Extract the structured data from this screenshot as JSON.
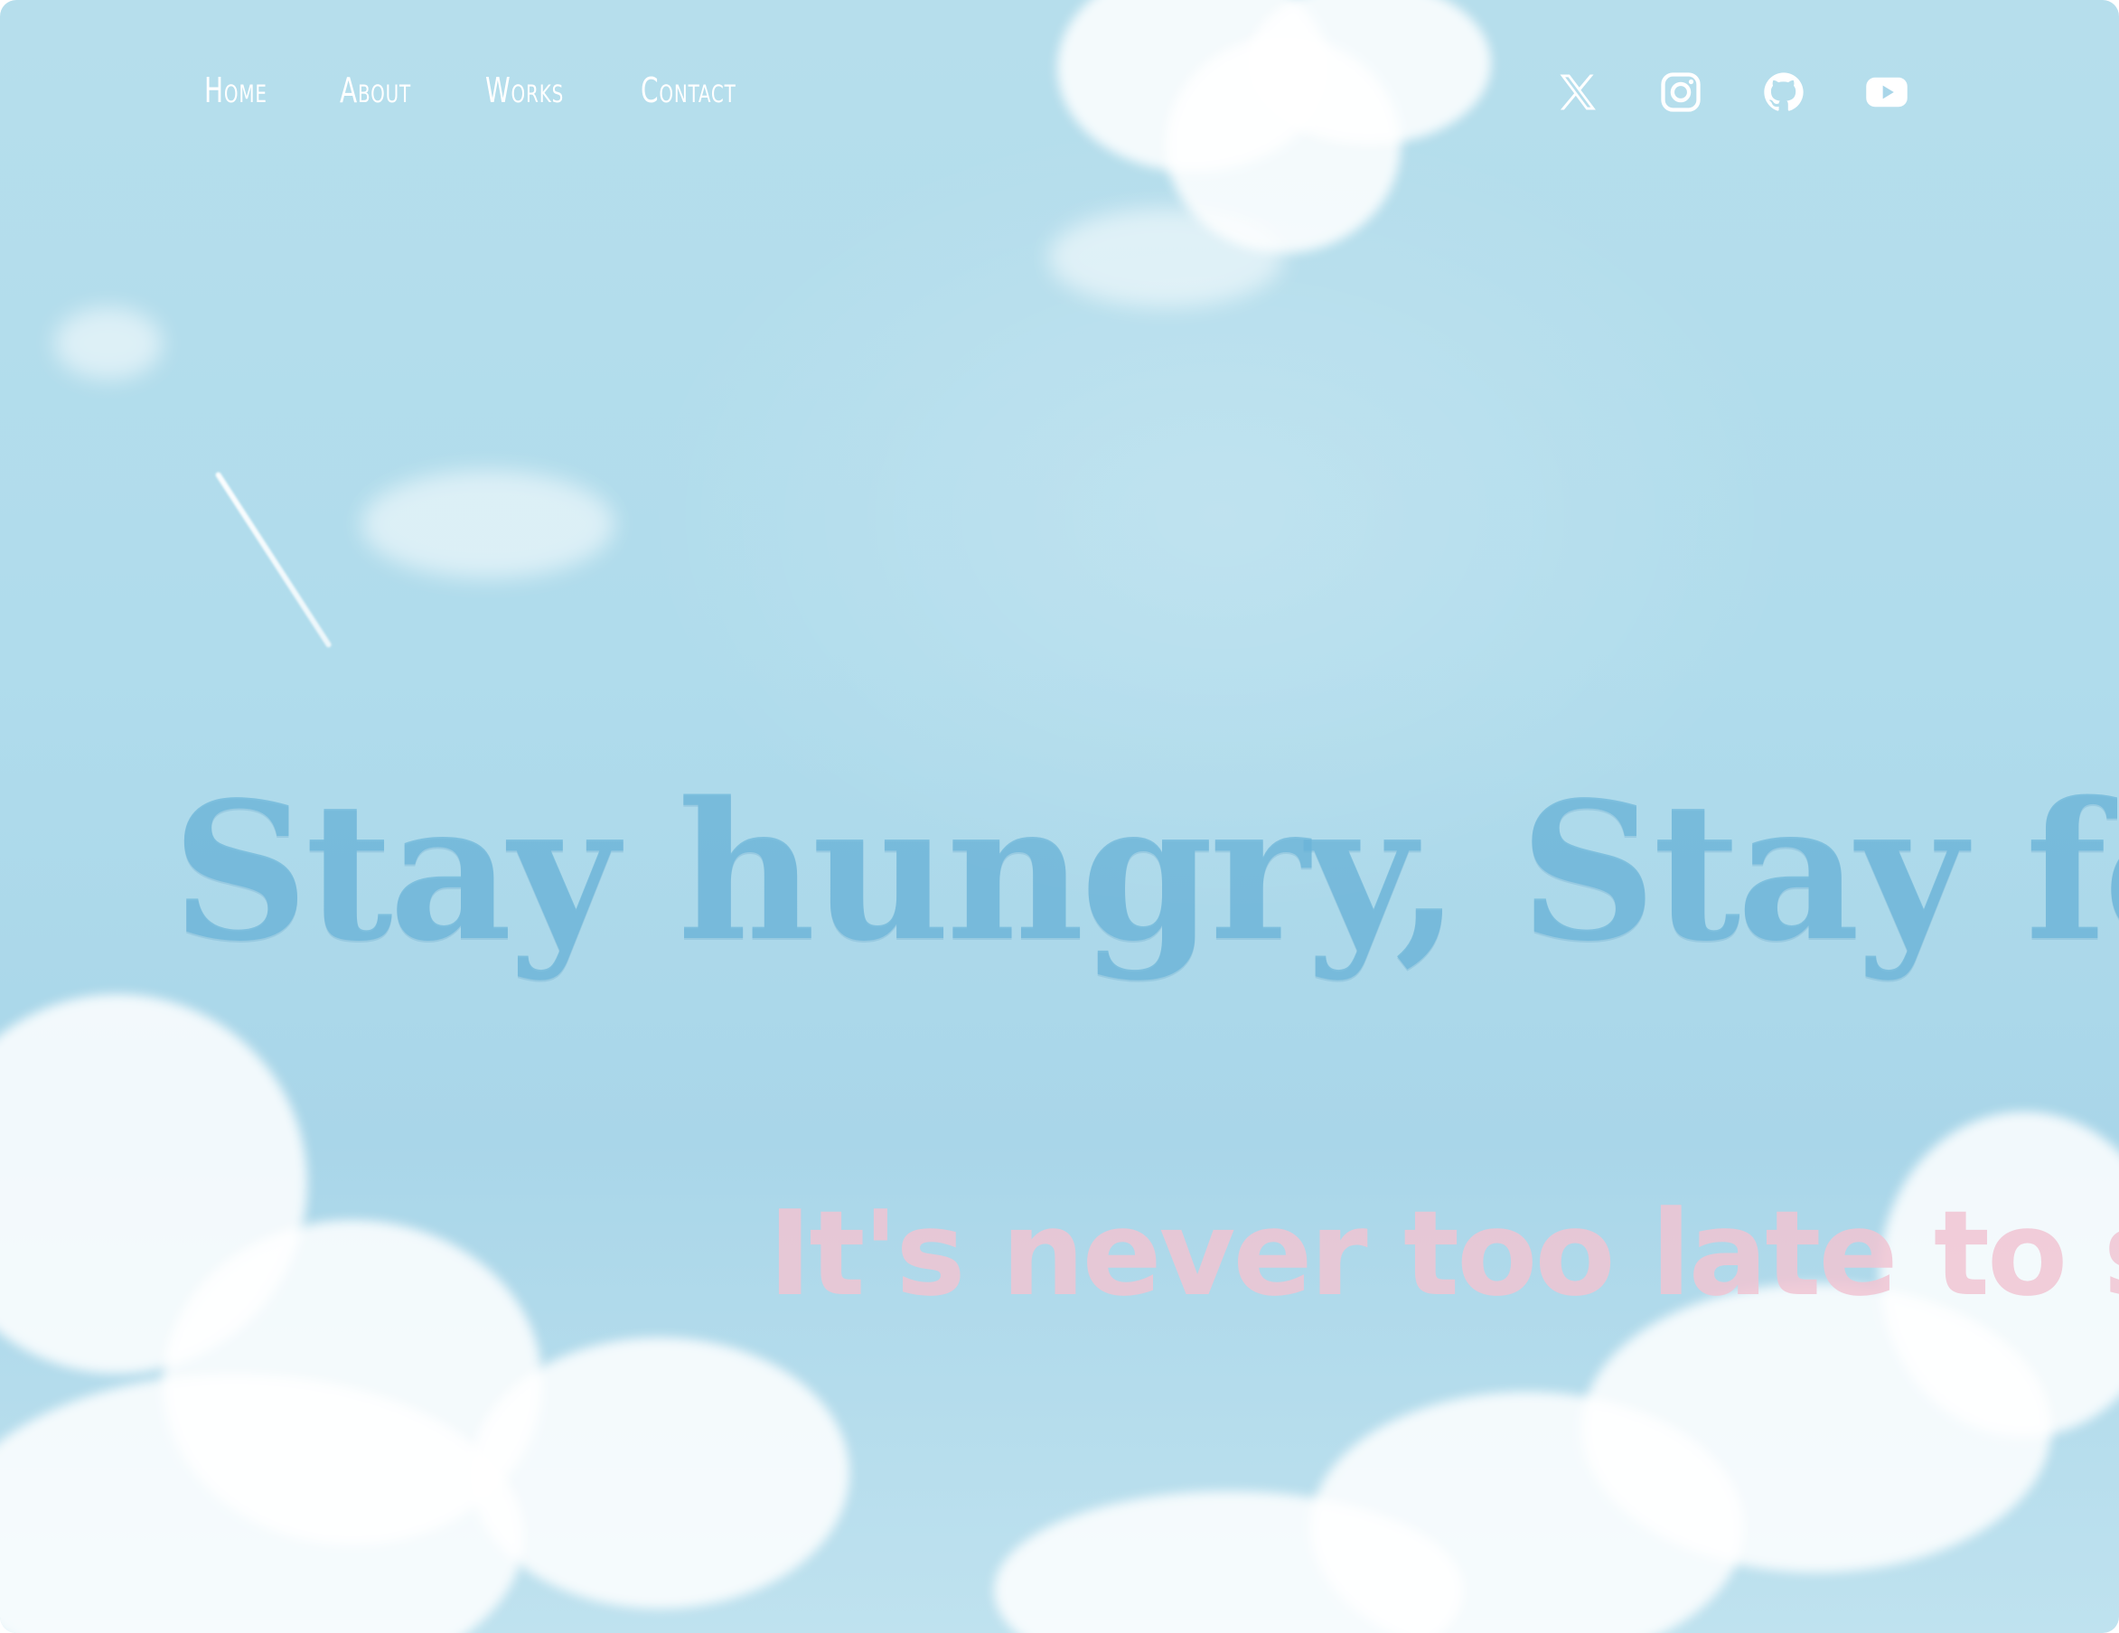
{
  "nav": {
    "items": [
      {
        "label": "Home"
      },
      {
        "label": "About"
      },
      {
        "label": "Works"
      },
      {
        "label": "Contact"
      }
    ]
  },
  "social": {
    "icons": [
      "x-icon",
      "instagram-icon",
      "github-icon",
      "youtube-icon"
    ]
  },
  "hero": {
    "headline": "Stay hungry, Stay foolish",
    "subline": "It's never too late to start."
  },
  "colors": {
    "sky": "#b0dcec",
    "headline": "#6bb4d8",
    "subline": "#f0c4d2",
    "nav_text": "#ffffff"
  }
}
